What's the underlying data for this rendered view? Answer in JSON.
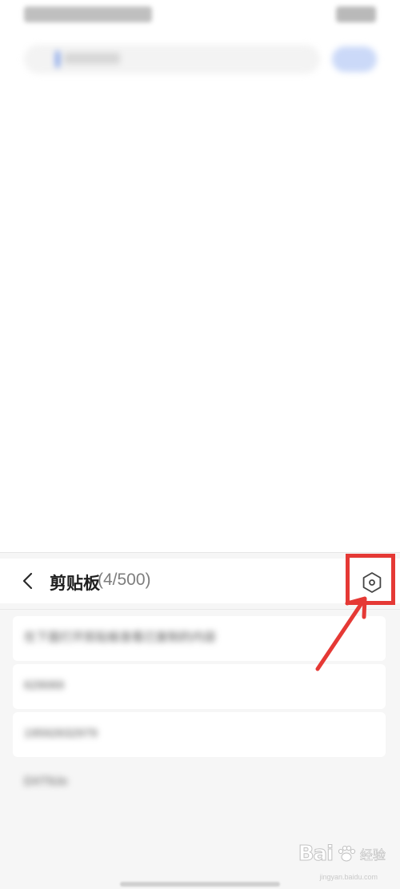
{
  "clipboard": {
    "title": "剪贴板",
    "count": "(4/500)",
    "items": [
      {
        "text": "在下面打开剪贴板查看已复制的内容"
      },
      {
        "text": "629069"
      },
      {
        "text": "19592632979"
      },
      {
        "text": "DXT9Jo"
      }
    ]
  },
  "icons": {
    "back": "chevron-left-icon",
    "settings": "hexagon-settings-icon"
  },
  "colors": {
    "annotation": "#e53935",
    "accent": "#5a84e6"
  },
  "watermark": {
    "logo": "Bai",
    "logo_end": "百",
    "subtitle": "经验",
    "url": "jingyan.baidu.com"
  }
}
